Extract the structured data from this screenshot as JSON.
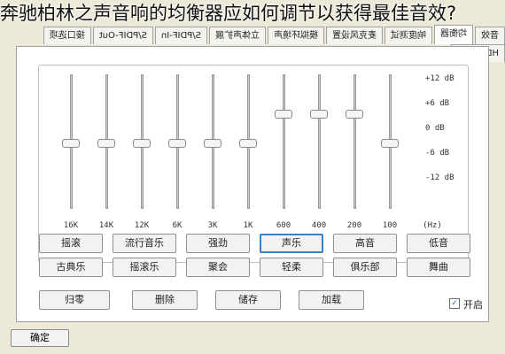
{
  "caption": "奔驰柏林之声音响的均衡器应如何调节以获得最佳音效?",
  "tabs": [
    "音效",
    "均衡器",
    "响度测试",
    "麦克风设置",
    "模拟环境声",
    "立体声扩展",
    "S/PDIF-In",
    "S/PDIF-Out",
    "接口选项",
    "HDMI设置"
  ],
  "eq": {
    "freq_labels": [
      "16K",
      "14K",
      "12K",
      "6K",
      "3K",
      "1K",
      "600",
      "400",
      "200",
      "100",
      "(Hz)"
    ],
    "db_labels": [
      "+12 dB",
      "+6 dB",
      "0 dB",
      "-6 dB",
      "-12 dB"
    ],
    "band_levels_db": [
      0,
      0,
      0,
      0,
      0,
      0,
      6,
      6,
      6,
      0
    ]
  },
  "presets": {
    "row1": [
      "低音",
      "高音",
      "声乐",
      "强劲",
      "流行音乐",
      "摇滚"
    ],
    "row2": [
      "舞曲",
      "俱乐部",
      "轻柔",
      "聚会",
      "摇滚乐",
      "古典乐"
    ],
    "selected": "声乐"
  },
  "actions": [
    "加载",
    "储存",
    "删除",
    "归零"
  ],
  "enable_label": "开启",
  "enable_checked": true,
  "ok_label": "确定",
  "colors": {
    "window": "#ece9d8",
    "accent": "#3c7fc9"
  }
}
